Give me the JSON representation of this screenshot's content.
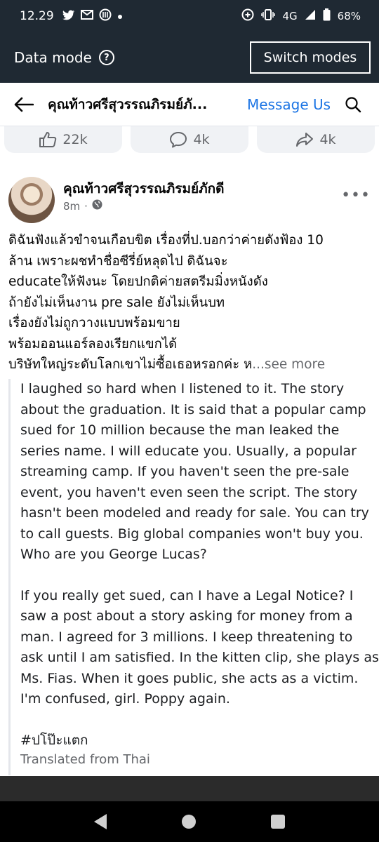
{
  "status_bar": {
    "time": "12.29",
    "network": "4G",
    "battery": "68%"
  },
  "data_mode": {
    "label": "Data mode",
    "help": "?",
    "switch_label": "Switch modes"
  },
  "header": {
    "title": "คุณท้าวศรีสุวรรณภิรมย์ภั...",
    "message_label": "Message Us"
  },
  "reactions": {
    "likes": "22k",
    "comments": "4k",
    "shares": "4k"
  },
  "post": {
    "author": "คุณท้าวศรีสุวรรณภิรมย์ภักดี",
    "time": "8m",
    "separator": "·",
    "thai_lines": [
      "ดิฉันฟังแล้วขำจนเกือบขิต เรื่องที่ป.บอกว่าค่ายดังฟ้อง 10",
      "ล้าน เพราะผชทำชื่อซีรี่ย์หลุดไป ดิฉันจะ",
      "educateให้ฟังนะ โดยปกติค่ายสตรีมมิ่งหนังดัง",
      "ถ้ายังไม่เห็นงาน pre sale ยังไม่เห็นบท",
      "เรื่องยังไม่ถูกวางแบบพร้อมขาย",
      "พร้อมออนแอร์ลองเรียกแขกได้",
      "บริษัทใหญ่ระดับโลกเขาไม่ซื้อเธอหรอกค่ะ ห"
    ],
    "see_more": "...see more",
    "translation_p1": "I laughed so hard when I listened to it. The story about the graduation. It is said that a popular camp sued for 10 million because the man leaked the series name. I will educate you. Usually, a popular streaming camp. If you haven't seen the pre-sale event, you haven't even seen the script. The story hasn't been modeled and ready for sale. You can try to call guests. Big global companies won't buy you. Who are you George Lucas?",
    "translation_p2": "If you really get sued, can I have a Legal Notice? I saw a post about a story asking for money from a man. I agreed for 3 millions. I keep threatening to ask until I am satisfied. In the kitten clip, she plays as Ms. Fias. When it goes public, she acts as a victim. I'm confused, girl. Poppy again.",
    "hashtag": "#ปโป๊ะแตก",
    "translated_label": "Translated from Thai"
  },
  "colors": {
    "dark_bar": "#1f2933",
    "link_blue": "#1b74e4",
    "muted": "#65676b"
  }
}
